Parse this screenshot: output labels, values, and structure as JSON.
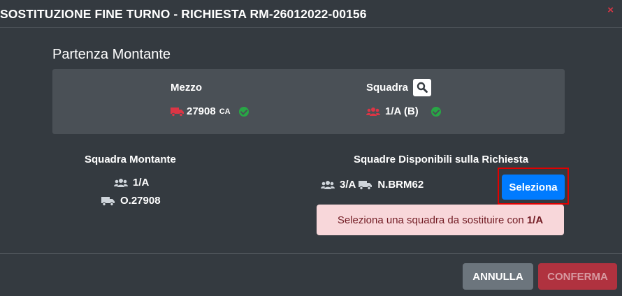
{
  "modal": {
    "title": "SOSTITUZIONE FINE TURNO - RICHIESTA RM-26012022-00156",
    "close_glyph": "×"
  },
  "section": {
    "title": "Partenza Montante",
    "mezzo_label": "Mezzo",
    "mezzo_code": "27908",
    "mezzo_suffix": "CA",
    "squadra_label": "Squadra",
    "squadra_value": "1/A (B)"
  },
  "montante": {
    "title": "Squadra Montante",
    "squadra": "1/A",
    "mezzo": "O.27908"
  },
  "disponibili": {
    "title": "Squadre Disponibili sulla Richiesta",
    "squadra": "3/A",
    "mezzo": "N.BRM62",
    "select_label": "Seleziona"
  },
  "alert": {
    "text_prefix": "Seleziona una squadra da sostituire con ",
    "text_bold": "1/A"
  },
  "footer": {
    "cancel_label": "ANNULLA",
    "confirm_label": "CONFERMA"
  },
  "colors": {
    "background": "#343a40",
    "panel": "#4a5056",
    "danger": "#dc3545",
    "success": "#28a745",
    "primary": "#007bff",
    "secondary": "#6c757d",
    "alert_bg": "#f8d7da"
  },
  "icons": {
    "truck": "truck-icon",
    "users": "users-icon",
    "search": "search-icon",
    "check": "check-circle-icon",
    "close": "close-icon"
  }
}
